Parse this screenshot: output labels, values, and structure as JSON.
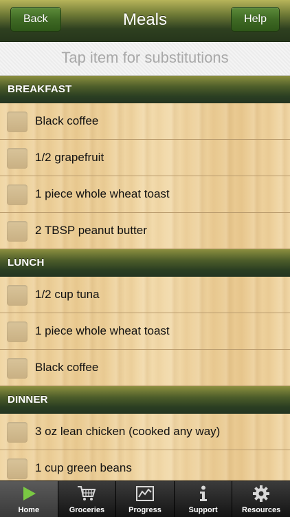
{
  "nav": {
    "back_label": "Back",
    "title": "Meals",
    "help_label": "Help"
  },
  "hint": "Tap item for substitutions",
  "sections": [
    {
      "title": "BREAKFAST",
      "items": [
        "Black coffee",
        "1/2 grapefruit",
        "1 piece whole wheat toast",
        "2 TBSP peanut butter"
      ]
    },
    {
      "title": "LUNCH",
      "items": [
        "1/2 cup tuna",
        "1 piece whole wheat toast",
        "Black coffee"
      ]
    },
    {
      "title": "DINNER",
      "items": [
        "3 oz lean chicken (cooked any way)",
        "1 cup green beans"
      ]
    }
  ],
  "tabs": [
    {
      "label": "Home",
      "icon": "play-icon",
      "active": true
    },
    {
      "label": "Groceries",
      "icon": "cart-icon",
      "active": false
    },
    {
      "label": "Progress",
      "icon": "chart-icon",
      "active": false
    },
    {
      "label": "Support",
      "icon": "info-icon",
      "active": false
    },
    {
      "label": "Resources",
      "icon": "gear-icon",
      "active": false
    }
  ],
  "colors": {
    "accent_green": "#7ac943",
    "header_dark": "#2b3f22"
  }
}
